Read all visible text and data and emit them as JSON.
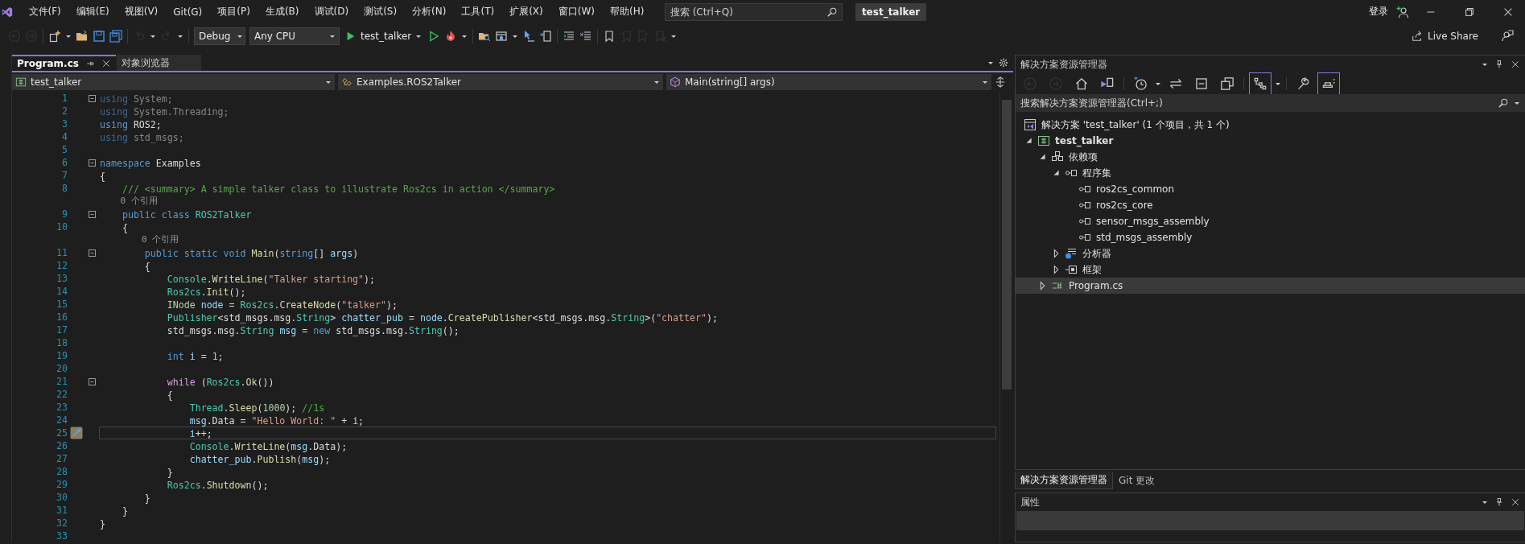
{
  "window": {
    "title": "test_talker"
  },
  "menu": [
    "文件(F)",
    "编辑(E)",
    "视图(V)",
    "Git(G)",
    "项目(P)",
    "生成(B)",
    "调试(D)",
    "测试(S)",
    "分析(N)",
    "工具(T)",
    "扩展(X)",
    "窗口(W)",
    "帮助(H)"
  ],
  "search": {
    "placeholder": "搜索 (Ctrl+Q)"
  },
  "account": {
    "sign_in": "登录"
  },
  "toolbar": {
    "groups": [
      [
        {
          "kind": "back",
          "disabled": true
        },
        {
          "kind": "forward",
          "disabled": true
        }
      ],
      [
        {
          "kind": "new_item",
          "disabled": false
        },
        {
          "kind": "open",
          "disabled": false
        },
        {
          "kind": "save",
          "disabled": false
        },
        {
          "kind": "save_all",
          "disabled": false
        }
      ],
      [
        {
          "kind": "undo",
          "disabled": true
        },
        {
          "kind": "redo",
          "disabled": true
        }
      ],
      [
        {
          "kind": "dropdown",
          "text": "Debug"
        },
        {
          "kind": "dropdown",
          "text": "Any CPU"
        },
        {
          "kind": "run",
          "text": "test_talker"
        },
        {
          "kind": "run_no_debug",
          "disabled": false
        },
        {
          "kind": "hot_reload",
          "disabled": false
        }
      ],
      [
        {
          "kind": "find_folder",
          "disabled": false
        },
        {
          "kind": "window",
          "disabled": false
        },
        {
          "kind": "cursor",
          "disabled": false
        },
        {
          "kind": "document",
          "disabled": false
        }
      ],
      [
        {
          "kind": "indent",
          "disabled": false
        },
        {
          "kind": "comment",
          "disabled": false
        }
      ],
      [
        {
          "kind": "bookmark",
          "disabled": false
        },
        {
          "kind": "bookmark_prev",
          "disabled": true
        },
        {
          "kind": "bookmark_next",
          "disabled": true
        },
        {
          "kind": "bookmark_clear",
          "disabled": true
        }
      ]
    ],
    "live_share": "Live Share"
  },
  "editor": {
    "tabs": [
      {
        "label": "Program.cs",
        "selected": true
      },
      {
        "label": "对象浏览器",
        "selected": false
      }
    ],
    "navigation": [
      "test_talker",
      "Examples.ROS2Talker",
      "Main(string[] args)"
    ],
    "lines": [
      {
        "number": "1",
        "fold": true,
        "current": false,
        "tokens": [
          {
            "kind": "unused_keyword",
            "text": "using"
          },
          {
            "kind": "unused",
            "text": " System;"
          }
        ]
      },
      {
        "number": "2",
        "fold": false,
        "current": false,
        "tokens": [
          {
            "kind": "unused_keyword",
            "text": "using"
          },
          {
            "kind": "unused",
            "text": " System.Threading;"
          }
        ]
      },
      {
        "number": "3",
        "fold": false,
        "current": false,
        "tokens": [
          {
            "kind": "keyword",
            "text": "using"
          },
          {
            "kind": "plain",
            "text": " ROS2;"
          }
        ]
      },
      {
        "number": "4",
        "fold": false,
        "current": false,
        "tokens": [
          {
            "kind": "unused_keyword",
            "text": "using"
          },
          {
            "kind": "unused",
            "text": " std_msgs;"
          }
        ]
      },
      {
        "number": "5",
        "fold": false,
        "current": false
      },
      {
        "number": "6",
        "fold": true,
        "current": false,
        "tokens": [
          {
            "kind": "keyword",
            "text": "namespace"
          },
          {
            "kind": "plain",
            "text": " Examples"
          }
        ]
      },
      {
        "number": "7",
        "fold": false,
        "current": false,
        "tokens": [
          {
            "kind": "plain",
            "text": "{"
          }
        ]
      },
      {
        "number": "8",
        "fold": false,
        "current": false,
        "tokens": [
          {
            "kind": "comment",
            "text": "    /// <summary> A simple talker class to illustrate Ros2cs in action </summary>"
          }
        ]
      },
      {
        "lens": "    0 个引用"
      },
      {
        "number": "9",
        "fold": true,
        "current": false,
        "tokens": [
          {
            "kind": "keyword",
            "text": "    public class"
          },
          {
            "kind": "type",
            "text": " ROS2Talker"
          }
        ]
      },
      {
        "number": "10",
        "fold": false,
        "current": false,
        "tokens": [
          {
            "kind": "plain",
            "text": "    {"
          }
        ]
      },
      {
        "lens": "        0 个引用"
      },
      {
        "number": "11",
        "fold": true,
        "current": false,
        "tokens": [
          {
            "kind": "keyword",
            "text": "        public static void"
          },
          {
            "kind": "method",
            "text": " Main"
          },
          {
            "kind": "plain",
            "text": "("
          },
          {
            "kind": "keyword",
            "text": "string"
          },
          {
            "kind": "plain",
            "text": "[] "
          },
          {
            "kind": "variable",
            "text": "args"
          },
          {
            "kind": "plain",
            "text": ")"
          }
        ]
      },
      {
        "number": "12",
        "fold": false,
        "current": false,
        "tokens": [
          {
            "kind": "plain",
            "text": "        {"
          }
        ]
      },
      {
        "number": "13",
        "fold": false,
        "current": false,
        "tokens": [
          {
            "kind": "type",
            "text": "            Console"
          },
          {
            "kind": "plain",
            "text": "."
          },
          {
            "kind": "method",
            "text": "WriteLine"
          },
          {
            "kind": "plain",
            "text": "("
          },
          {
            "kind": "string",
            "text": "\"Talker starting\""
          },
          {
            "kind": "plain",
            "text": ");"
          }
        ]
      },
      {
        "number": "14",
        "fold": false,
        "current": false,
        "tokens": [
          {
            "kind": "type",
            "text": "            Ros2cs"
          },
          {
            "kind": "method",
            "text": ".Init"
          },
          {
            "kind": "plain",
            "text": "();"
          }
        ]
      },
      {
        "number": "15",
        "fold": false,
        "current": false,
        "tokens": [
          {
            "kind": "interface",
            "text": "            INode"
          },
          {
            "kind": "variable",
            "text": " node"
          },
          {
            "kind": "plain",
            "text": " = "
          },
          {
            "kind": "type",
            "text": "Ros2cs"
          },
          {
            "kind": "plain",
            "text": "."
          },
          {
            "kind": "method",
            "text": "CreateNode"
          },
          {
            "kind": "plain",
            "text": "("
          },
          {
            "kind": "string",
            "text": "\"talker\""
          },
          {
            "kind": "plain",
            "text": ");"
          }
        ]
      },
      {
        "number": "16",
        "fold": false,
        "current": false,
        "tokens": [
          {
            "kind": "type",
            "text": "            Publisher"
          },
          {
            "kind": "plain",
            "text": "<std_msgs.msg."
          },
          {
            "kind": "type",
            "text": "String"
          },
          {
            "kind": "plain",
            "text": "> "
          },
          {
            "kind": "variable",
            "text": "chatter_pub"
          },
          {
            "kind": "plain",
            "text": " = "
          },
          {
            "kind": "variable",
            "text": "node"
          },
          {
            "kind": "plain",
            "text": "."
          },
          {
            "kind": "method",
            "text": "CreatePublisher"
          },
          {
            "kind": "plain",
            "text": "<std_msgs.msg."
          },
          {
            "kind": "type",
            "text": "String"
          },
          {
            "kind": "plain",
            "text": ">("
          },
          {
            "kind": "string",
            "text": "\"chatter\""
          },
          {
            "kind": "plain",
            "text": ");"
          }
        ]
      },
      {
        "number": "17",
        "fold": false,
        "current": false,
        "tokens": [
          {
            "kind": "plain",
            "text": "            std_msgs.msg."
          },
          {
            "kind": "type",
            "text": "String"
          },
          {
            "kind": "variable",
            "text": " msg"
          },
          {
            "kind": "plain",
            "text": " = "
          },
          {
            "kind": "keyword",
            "text": "new"
          },
          {
            "kind": "plain",
            "text": " std_msgs.msg."
          },
          {
            "kind": "type",
            "text": "String"
          },
          {
            "kind": "plain",
            "text": "();"
          }
        ]
      },
      {
        "number": "18",
        "fold": false,
        "current": false
      },
      {
        "number": "19",
        "fold": false,
        "current": false,
        "tokens": [
          {
            "kind": "keyword",
            "text": "            int"
          },
          {
            "kind": "variable",
            "text": " i"
          },
          {
            "kind": "plain",
            "text": " = "
          },
          {
            "kind": "number",
            "text": "1"
          },
          {
            "kind": "plain",
            "text": ";"
          }
        ]
      },
      {
        "number": "20",
        "fold": false,
        "current": false
      },
      {
        "number": "21",
        "fold": true,
        "current": false,
        "tokens": [
          {
            "kind": "control",
            "text": "            while"
          },
          {
            "kind": "plain",
            "text": " ("
          },
          {
            "kind": "type",
            "text": "Ros2cs"
          },
          {
            "kind": "plain",
            "text": "."
          },
          {
            "kind": "method",
            "text": "Ok"
          },
          {
            "kind": "plain",
            "text": "())"
          }
        ]
      },
      {
        "number": "22",
        "fold": false,
        "current": false,
        "tokens": [
          {
            "kind": "plain",
            "text": "            {"
          }
        ]
      },
      {
        "number": "23",
        "fold": false,
        "current": false,
        "tokens": [
          {
            "kind": "type",
            "text": "                Thread"
          },
          {
            "kind": "plain",
            "text": "."
          },
          {
            "kind": "method",
            "text": "Sleep"
          },
          {
            "kind": "plain",
            "text": "("
          },
          {
            "kind": "number",
            "text": "1000"
          },
          {
            "kind": "plain",
            "text": "); "
          },
          {
            "kind": "comment",
            "text": "//1s"
          }
        ]
      },
      {
        "number": "24",
        "fold": false,
        "current": false,
        "tokens": [
          {
            "kind": "variable",
            "text": "                msg"
          },
          {
            "kind": "plain",
            "text": ".Data = "
          },
          {
            "kind": "string",
            "text": "\"Hello World: \""
          },
          {
            "kind": "plain",
            "text": " + "
          },
          {
            "kind": "variable",
            "text": "i"
          },
          {
            "kind": "plain",
            "text": ";"
          }
        ]
      },
      {
        "number": "25",
        "fold": false,
        "current": true,
        "tokens": [
          {
            "kind": "variable",
            "text": "                i"
          },
          {
            "kind": "plain",
            "text": "++;"
          }
        ]
      },
      {
        "number": "26",
        "fold": false,
        "current": false,
        "tokens": [
          {
            "kind": "type",
            "text": "                Console"
          },
          {
            "kind": "plain",
            "text": "."
          },
          {
            "kind": "method",
            "text": "WriteLine"
          },
          {
            "kind": "plain",
            "text": "("
          },
          {
            "kind": "variable",
            "text": "msg"
          },
          {
            "kind": "plain",
            "text": ".Data);"
          }
        ]
      },
      {
        "number": "27",
        "fold": false,
        "current": false,
        "tokens": [
          {
            "kind": "variable",
            "text": "                chatter_pub"
          },
          {
            "kind": "plain",
            "text": "."
          },
          {
            "kind": "method",
            "text": "Publish"
          },
          {
            "kind": "plain",
            "text": "("
          },
          {
            "kind": "variable",
            "text": "msg"
          },
          {
            "kind": "plain",
            "text": ");"
          }
        ]
      },
      {
        "number": "28",
        "fold": false,
        "current": false,
        "tokens": [
          {
            "kind": "plain",
            "text": "            }"
          }
        ]
      },
      {
        "number": "29",
        "fold": false,
        "current": false,
        "tokens": [
          {
            "kind": "type",
            "text": "            Ros2cs"
          },
          {
            "kind": "plain",
            "text": "."
          },
          {
            "kind": "method",
            "text": "Shutdown"
          },
          {
            "kind": "plain",
            "text": "();"
          }
        ]
      },
      {
        "number": "30",
        "fold": false,
        "current": false,
        "tokens": [
          {
            "kind": "plain",
            "text": "        }"
          }
        ]
      },
      {
        "number": "31",
        "fold": false,
        "current": false,
        "tokens": [
          {
            "kind": "plain",
            "text": "    }"
          }
        ]
      },
      {
        "number": "32",
        "fold": false,
        "current": false,
        "tokens": [
          {
            "kind": "plain",
            "text": "}"
          }
        ]
      },
      {
        "number": "33",
        "fold": false,
        "current": false
      }
    ]
  },
  "solution_explorer": {
    "title": "解决方案资源管理器",
    "toolbar": [
      {
        "kind": "back",
        "disabled": true,
        "on": false
      },
      {
        "kind": "forward",
        "disabled": true,
        "on": false
      },
      {
        "kind": "home",
        "disabled": false,
        "on": false
      },
      {
        "kind": "switch_views",
        "disabled": false,
        "on": false
      },
      {
        "kind": "pending_filter",
        "disabled": false,
        "on": false
      },
      {
        "kind": "sync",
        "disabled": false,
        "on": false
      },
      {
        "kind": "collapse_all",
        "disabled": false,
        "on": false
      },
      {
        "kind": "show_all",
        "disabled": false,
        "on": false
      },
      {
        "kind": "view_mode",
        "disabled": false,
        "on": true
      },
      {
        "kind": "properties",
        "disabled": false,
        "on": false
      },
      {
        "kind": "preview",
        "disabled": false,
        "on": true
      }
    ],
    "search": {
      "placeholder": "搜索解决方案资源管理器(Ctrl+;)"
    },
    "tree": [
      {
        "label": "解决方案 'test_talker' (1 个项目，共 1 个)",
        "kind": "solution",
        "selected": false,
        "children": [
          {
            "label": "test_talker",
            "kind": "project",
            "expanded": true,
            "selected": false,
            "children": [
              {
                "label": "依赖项",
                "kind": "dependencies",
                "expanded": true,
                "selected": false,
                "children": [
                  {
                    "label": "程序集",
                    "kind": "assemblies",
                    "expanded": true,
                    "selected": false,
                    "children": [
                      {
                        "label": "ros2cs_common",
                        "kind": "assembly",
                        "selected": false
                      },
                      {
                        "label": "ros2cs_core",
                        "kind": "assembly",
                        "selected": false
                      },
                      {
                        "label": "sensor_msgs_assembly",
                        "kind": "assembly",
                        "selected": false
                      },
                      {
                        "label": "std_msgs_assembly",
                        "kind": "assembly",
                        "selected": false
                      }
                    ]
                  },
                  {
                    "label": "分析器",
                    "kind": "analyzers",
                    "expanded": false,
                    "selected": false
                  },
                  {
                    "label": "框架",
                    "kind": "frameworks",
                    "expanded": false,
                    "selected": false
                  }
                ]
              },
              {
                "label": "Program.cs",
                "kind": "file",
                "expanded": false,
                "selected": true
              }
            ]
          }
        ]
      }
    ],
    "bottom_tabs": [
      {
        "label": "解决方案资源管理器",
        "selected": true
      },
      {
        "label": "Git 更改",
        "selected": false
      }
    ]
  },
  "properties": {
    "title": "属性"
  }
}
